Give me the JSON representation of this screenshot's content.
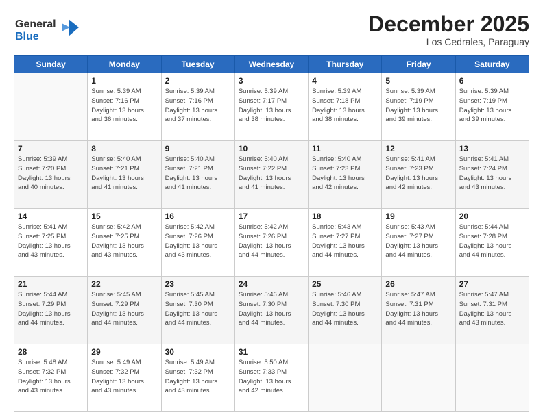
{
  "logo": {
    "line1": "General",
    "line2": "Blue"
  },
  "header": {
    "month": "December 2025",
    "location": "Los Cedrales, Paraguay"
  },
  "weekdays": [
    "Sunday",
    "Monday",
    "Tuesday",
    "Wednesday",
    "Thursday",
    "Friday",
    "Saturday"
  ],
  "weeks": [
    [
      {
        "day": "",
        "info": ""
      },
      {
        "day": "1",
        "info": "Sunrise: 5:39 AM\nSunset: 7:16 PM\nDaylight: 13 hours\nand 36 minutes."
      },
      {
        "day": "2",
        "info": "Sunrise: 5:39 AM\nSunset: 7:16 PM\nDaylight: 13 hours\nand 37 minutes."
      },
      {
        "day": "3",
        "info": "Sunrise: 5:39 AM\nSunset: 7:17 PM\nDaylight: 13 hours\nand 38 minutes."
      },
      {
        "day": "4",
        "info": "Sunrise: 5:39 AM\nSunset: 7:18 PM\nDaylight: 13 hours\nand 38 minutes."
      },
      {
        "day": "5",
        "info": "Sunrise: 5:39 AM\nSunset: 7:19 PM\nDaylight: 13 hours\nand 39 minutes."
      },
      {
        "day": "6",
        "info": "Sunrise: 5:39 AM\nSunset: 7:19 PM\nDaylight: 13 hours\nand 39 minutes."
      }
    ],
    [
      {
        "day": "7",
        "info": "Sunrise: 5:39 AM\nSunset: 7:20 PM\nDaylight: 13 hours\nand 40 minutes."
      },
      {
        "day": "8",
        "info": "Sunrise: 5:40 AM\nSunset: 7:21 PM\nDaylight: 13 hours\nand 41 minutes."
      },
      {
        "day": "9",
        "info": "Sunrise: 5:40 AM\nSunset: 7:21 PM\nDaylight: 13 hours\nand 41 minutes."
      },
      {
        "day": "10",
        "info": "Sunrise: 5:40 AM\nSunset: 7:22 PM\nDaylight: 13 hours\nand 41 minutes."
      },
      {
        "day": "11",
        "info": "Sunrise: 5:40 AM\nSunset: 7:23 PM\nDaylight: 13 hours\nand 42 minutes."
      },
      {
        "day": "12",
        "info": "Sunrise: 5:41 AM\nSunset: 7:23 PM\nDaylight: 13 hours\nand 42 minutes."
      },
      {
        "day": "13",
        "info": "Sunrise: 5:41 AM\nSunset: 7:24 PM\nDaylight: 13 hours\nand 43 minutes."
      }
    ],
    [
      {
        "day": "14",
        "info": "Sunrise: 5:41 AM\nSunset: 7:25 PM\nDaylight: 13 hours\nand 43 minutes."
      },
      {
        "day": "15",
        "info": "Sunrise: 5:42 AM\nSunset: 7:25 PM\nDaylight: 13 hours\nand 43 minutes."
      },
      {
        "day": "16",
        "info": "Sunrise: 5:42 AM\nSunset: 7:26 PM\nDaylight: 13 hours\nand 43 minutes."
      },
      {
        "day": "17",
        "info": "Sunrise: 5:42 AM\nSunset: 7:26 PM\nDaylight: 13 hours\nand 44 minutes."
      },
      {
        "day": "18",
        "info": "Sunrise: 5:43 AM\nSunset: 7:27 PM\nDaylight: 13 hours\nand 44 minutes."
      },
      {
        "day": "19",
        "info": "Sunrise: 5:43 AM\nSunset: 7:27 PM\nDaylight: 13 hours\nand 44 minutes."
      },
      {
        "day": "20",
        "info": "Sunrise: 5:44 AM\nSunset: 7:28 PM\nDaylight: 13 hours\nand 44 minutes."
      }
    ],
    [
      {
        "day": "21",
        "info": "Sunrise: 5:44 AM\nSunset: 7:29 PM\nDaylight: 13 hours\nand 44 minutes."
      },
      {
        "day": "22",
        "info": "Sunrise: 5:45 AM\nSunset: 7:29 PM\nDaylight: 13 hours\nand 44 minutes."
      },
      {
        "day": "23",
        "info": "Sunrise: 5:45 AM\nSunset: 7:30 PM\nDaylight: 13 hours\nand 44 minutes."
      },
      {
        "day": "24",
        "info": "Sunrise: 5:46 AM\nSunset: 7:30 PM\nDaylight: 13 hours\nand 44 minutes."
      },
      {
        "day": "25",
        "info": "Sunrise: 5:46 AM\nSunset: 7:30 PM\nDaylight: 13 hours\nand 44 minutes."
      },
      {
        "day": "26",
        "info": "Sunrise: 5:47 AM\nSunset: 7:31 PM\nDaylight: 13 hours\nand 44 minutes."
      },
      {
        "day": "27",
        "info": "Sunrise: 5:47 AM\nSunset: 7:31 PM\nDaylight: 13 hours\nand 43 minutes."
      }
    ],
    [
      {
        "day": "28",
        "info": "Sunrise: 5:48 AM\nSunset: 7:32 PM\nDaylight: 13 hours\nand 43 minutes."
      },
      {
        "day": "29",
        "info": "Sunrise: 5:49 AM\nSunset: 7:32 PM\nDaylight: 13 hours\nand 43 minutes."
      },
      {
        "day": "30",
        "info": "Sunrise: 5:49 AM\nSunset: 7:32 PM\nDaylight: 13 hours\nand 43 minutes."
      },
      {
        "day": "31",
        "info": "Sunrise: 5:50 AM\nSunset: 7:33 PM\nDaylight: 13 hours\nand 42 minutes."
      },
      {
        "day": "",
        "info": ""
      },
      {
        "day": "",
        "info": ""
      },
      {
        "day": "",
        "info": ""
      }
    ]
  ]
}
